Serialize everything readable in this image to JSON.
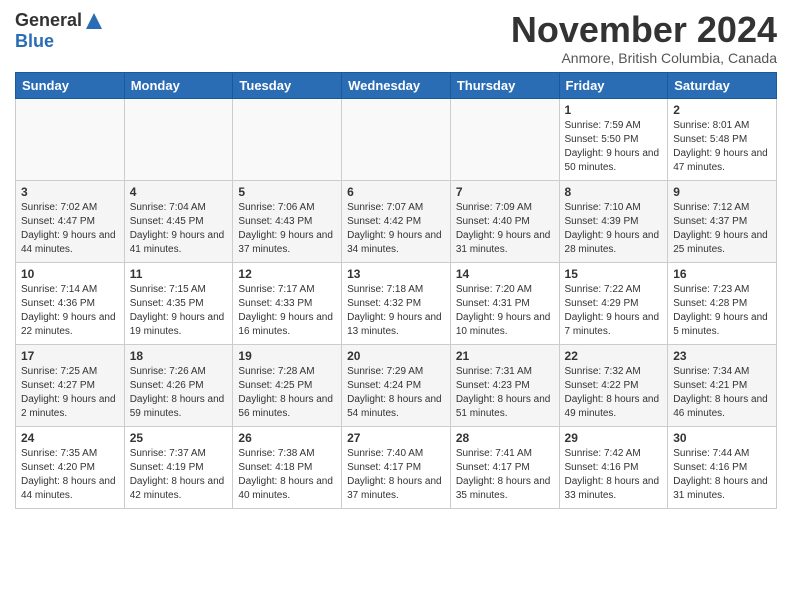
{
  "logo": {
    "general": "General",
    "blue": "Blue"
  },
  "title": {
    "month_year": "November 2024",
    "location": "Anmore, British Columbia, Canada"
  },
  "days_of_week": [
    "Sunday",
    "Monday",
    "Tuesday",
    "Wednesday",
    "Thursday",
    "Friday",
    "Saturday"
  ],
  "weeks": [
    [
      {
        "day": "",
        "info": ""
      },
      {
        "day": "",
        "info": ""
      },
      {
        "day": "",
        "info": ""
      },
      {
        "day": "",
        "info": ""
      },
      {
        "day": "",
        "info": ""
      },
      {
        "day": "1",
        "info": "Sunrise: 7:59 AM\nSunset: 5:50 PM\nDaylight: 9 hours and 50 minutes."
      },
      {
        "day": "2",
        "info": "Sunrise: 8:01 AM\nSunset: 5:48 PM\nDaylight: 9 hours and 47 minutes."
      }
    ],
    [
      {
        "day": "3",
        "info": "Sunrise: 7:02 AM\nSunset: 4:47 PM\nDaylight: 9 hours and 44 minutes."
      },
      {
        "day": "4",
        "info": "Sunrise: 7:04 AM\nSunset: 4:45 PM\nDaylight: 9 hours and 41 minutes."
      },
      {
        "day": "5",
        "info": "Sunrise: 7:06 AM\nSunset: 4:43 PM\nDaylight: 9 hours and 37 minutes."
      },
      {
        "day": "6",
        "info": "Sunrise: 7:07 AM\nSunset: 4:42 PM\nDaylight: 9 hours and 34 minutes."
      },
      {
        "day": "7",
        "info": "Sunrise: 7:09 AM\nSunset: 4:40 PM\nDaylight: 9 hours and 31 minutes."
      },
      {
        "day": "8",
        "info": "Sunrise: 7:10 AM\nSunset: 4:39 PM\nDaylight: 9 hours and 28 minutes."
      },
      {
        "day": "9",
        "info": "Sunrise: 7:12 AM\nSunset: 4:37 PM\nDaylight: 9 hours and 25 minutes."
      }
    ],
    [
      {
        "day": "10",
        "info": "Sunrise: 7:14 AM\nSunset: 4:36 PM\nDaylight: 9 hours and 22 minutes."
      },
      {
        "day": "11",
        "info": "Sunrise: 7:15 AM\nSunset: 4:35 PM\nDaylight: 9 hours and 19 minutes."
      },
      {
        "day": "12",
        "info": "Sunrise: 7:17 AM\nSunset: 4:33 PM\nDaylight: 9 hours and 16 minutes."
      },
      {
        "day": "13",
        "info": "Sunrise: 7:18 AM\nSunset: 4:32 PM\nDaylight: 9 hours and 13 minutes."
      },
      {
        "day": "14",
        "info": "Sunrise: 7:20 AM\nSunset: 4:31 PM\nDaylight: 9 hours and 10 minutes."
      },
      {
        "day": "15",
        "info": "Sunrise: 7:22 AM\nSunset: 4:29 PM\nDaylight: 9 hours and 7 minutes."
      },
      {
        "day": "16",
        "info": "Sunrise: 7:23 AM\nSunset: 4:28 PM\nDaylight: 9 hours and 5 minutes."
      }
    ],
    [
      {
        "day": "17",
        "info": "Sunrise: 7:25 AM\nSunset: 4:27 PM\nDaylight: 9 hours and 2 minutes."
      },
      {
        "day": "18",
        "info": "Sunrise: 7:26 AM\nSunset: 4:26 PM\nDaylight: 8 hours and 59 minutes."
      },
      {
        "day": "19",
        "info": "Sunrise: 7:28 AM\nSunset: 4:25 PM\nDaylight: 8 hours and 56 minutes."
      },
      {
        "day": "20",
        "info": "Sunrise: 7:29 AM\nSunset: 4:24 PM\nDaylight: 8 hours and 54 minutes."
      },
      {
        "day": "21",
        "info": "Sunrise: 7:31 AM\nSunset: 4:23 PM\nDaylight: 8 hours and 51 minutes."
      },
      {
        "day": "22",
        "info": "Sunrise: 7:32 AM\nSunset: 4:22 PM\nDaylight: 8 hours and 49 minutes."
      },
      {
        "day": "23",
        "info": "Sunrise: 7:34 AM\nSunset: 4:21 PM\nDaylight: 8 hours and 46 minutes."
      }
    ],
    [
      {
        "day": "24",
        "info": "Sunrise: 7:35 AM\nSunset: 4:20 PM\nDaylight: 8 hours and 44 minutes."
      },
      {
        "day": "25",
        "info": "Sunrise: 7:37 AM\nSunset: 4:19 PM\nDaylight: 8 hours and 42 minutes."
      },
      {
        "day": "26",
        "info": "Sunrise: 7:38 AM\nSunset: 4:18 PM\nDaylight: 8 hours and 40 minutes."
      },
      {
        "day": "27",
        "info": "Sunrise: 7:40 AM\nSunset: 4:17 PM\nDaylight: 8 hours and 37 minutes."
      },
      {
        "day": "28",
        "info": "Sunrise: 7:41 AM\nSunset: 4:17 PM\nDaylight: 8 hours and 35 minutes."
      },
      {
        "day": "29",
        "info": "Sunrise: 7:42 AM\nSunset: 4:16 PM\nDaylight: 8 hours and 33 minutes."
      },
      {
        "day": "30",
        "info": "Sunrise: 7:44 AM\nSunset: 4:16 PM\nDaylight: 8 hours and 31 minutes."
      }
    ]
  ]
}
